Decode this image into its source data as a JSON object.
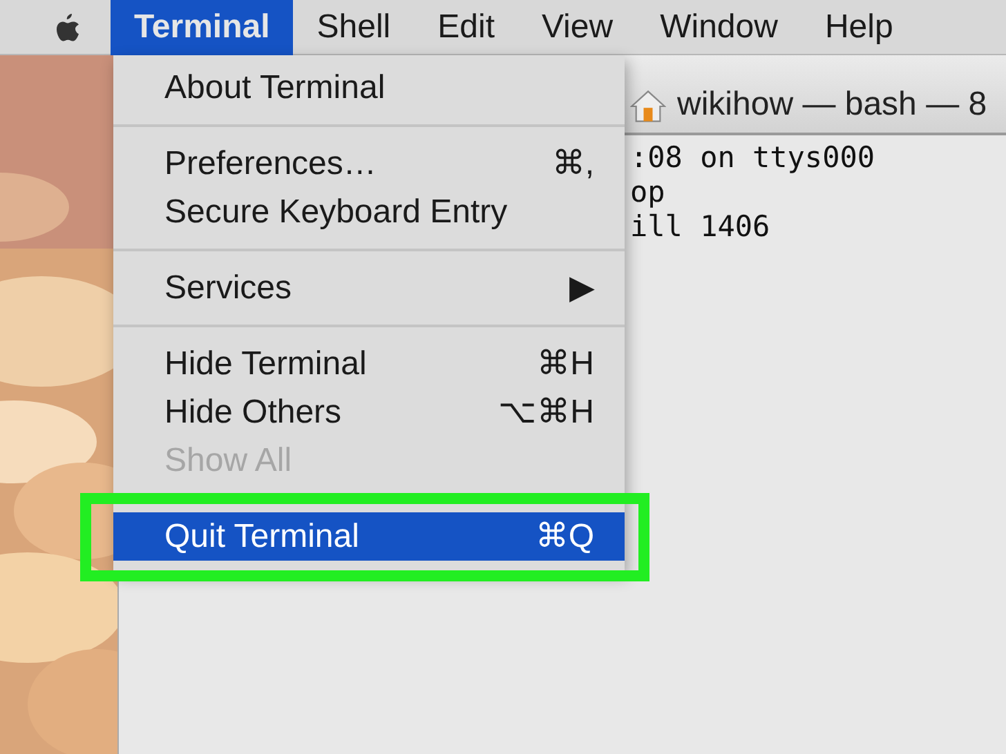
{
  "menu_bar": {
    "items": [
      {
        "label": "Terminal",
        "selected": true
      },
      {
        "label": "Shell",
        "selected": false
      },
      {
        "label": "Edit",
        "selected": false
      },
      {
        "label": "View",
        "selected": false
      },
      {
        "label": "Window",
        "selected": false
      },
      {
        "label": "Help",
        "selected": false
      }
    ]
  },
  "terminal_window": {
    "title": "wikihow — bash — 8",
    "lines": [
      ":08 on ttys000",
      "op",
      "ill 1406"
    ]
  },
  "menu": {
    "groups": [
      [
        {
          "label": "About Terminal",
          "disabled": false,
          "selected": false,
          "annotated": false
        }
      ],
      [
        {
          "label": "Preferences…",
          "shortcut": "⌘,",
          "disabled": false,
          "selected": false,
          "annotated": false
        },
        {
          "label": "Secure Keyboard Entry",
          "disabled": false,
          "selected": false,
          "annotated": false
        }
      ],
      [
        {
          "label": "Services",
          "submenu": "▶",
          "disabled": false,
          "selected": false,
          "annotated": false
        }
      ],
      [
        {
          "label": "Hide Terminal",
          "shortcut": "⌘H",
          "disabled": false,
          "selected": false,
          "annotated": false
        },
        {
          "label": "Hide Others",
          "shortcut": "⌥⌘H",
          "disabled": false,
          "selected": false,
          "annotated": false
        },
        {
          "label": "Show All",
          "disabled": true,
          "selected": false,
          "annotated": false
        }
      ],
      [
        {
          "label": "Quit Terminal",
          "shortcut": "⌘Q",
          "disabled": false,
          "selected": true,
          "annotated": true
        }
      ]
    ]
  }
}
